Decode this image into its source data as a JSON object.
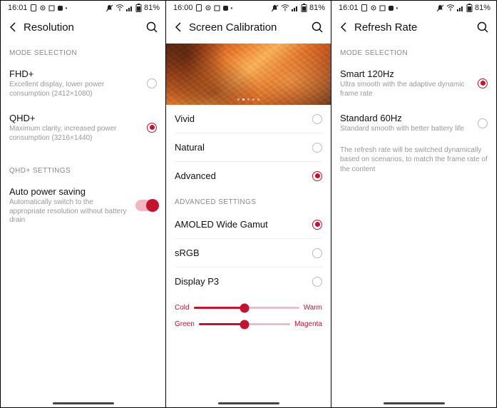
{
  "statusbar": {
    "time_a": "16:01",
    "time_b": "16:00",
    "time_c": "16:01",
    "battery_pct": "81%"
  },
  "panel1": {
    "title": "Resolution",
    "section1": "MODE SELECTION",
    "fhd": {
      "label": "FHD+",
      "sub": "Excellent display, lower power consumption (2412×1080)"
    },
    "qhd": {
      "label": "QHD+",
      "sub": "Maximum clarity, increased power consumption (3216×1440)"
    },
    "section2": "QHD+ SETTINGS",
    "auto": {
      "label": "Auto power saving",
      "sub": "Automatically switch to the appropriate resolution without battery drain"
    }
  },
  "panel2": {
    "title": "Screen Calibration",
    "opt_vivid": "Vivid",
    "opt_natural": "Natural",
    "opt_advanced": "Advanced",
    "section_adv": "ADVANCED SETTINGS",
    "opt_wide": "AMOLED Wide Gamut",
    "opt_srgb": "sRGB",
    "opt_p3": "Display P3",
    "slider1": {
      "left": "Cold",
      "right": "Warm",
      "pct": 48
    },
    "slider2": {
      "left": "Green",
      "right": "Magenta",
      "pct": 50
    }
  },
  "panel3": {
    "title": "Refresh Rate",
    "section1": "MODE SELECTION",
    "smart": {
      "label": "Smart 120Hz",
      "sub": "Ultra smooth with the adaptive dynamic frame rate"
    },
    "std": {
      "label": "Standard 60Hz",
      "sub": "Standard smooth with better battery life"
    },
    "note": "The refresh rate will be switched dynamically based on scenarios, to match the frame rate of the content"
  }
}
